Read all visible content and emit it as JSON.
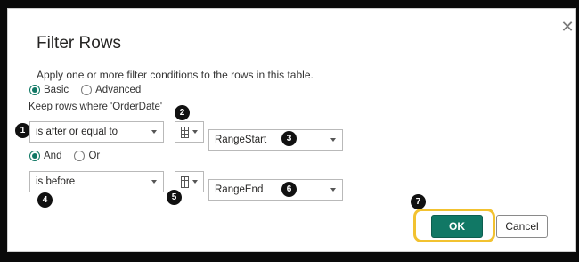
{
  "dialog": {
    "title": "Filter Rows",
    "description": "Apply one or more filter conditions to the rows in this table.",
    "close_glyph": "✕",
    "mode_options": [
      {
        "label": "Basic",
        "selected": true
      },
      {
        "label": "Advanced",
        "selected": false
      }
    ],
    "keep_rows_label": "Keep rows where 'OrderDate'",
    "condition1": {
      "operator": "is after or equal to",
      "value": "RangeStart"
    },
    "logic_options": [
      {
        "label": "And",
        "selected": true
      },
      {
        "label": "Or",
        "selected": false
      }
    ],
    "condition2": {
      "operator": "is before",
      "value": "RangeEnd"
    },
    "buttons": {
      "ok": "OK",
      "cancel": "Cancel"
    }
  },
  "callouts": [
    "1",
    "2",
    "3",
    "4",
    "5",
    "6",
    "7"
  ],
  "colors": {
    "accent": "#117865",
    "highlight": "#f2c230",
    "backdrop": "#0a0a0a"
  }
}
